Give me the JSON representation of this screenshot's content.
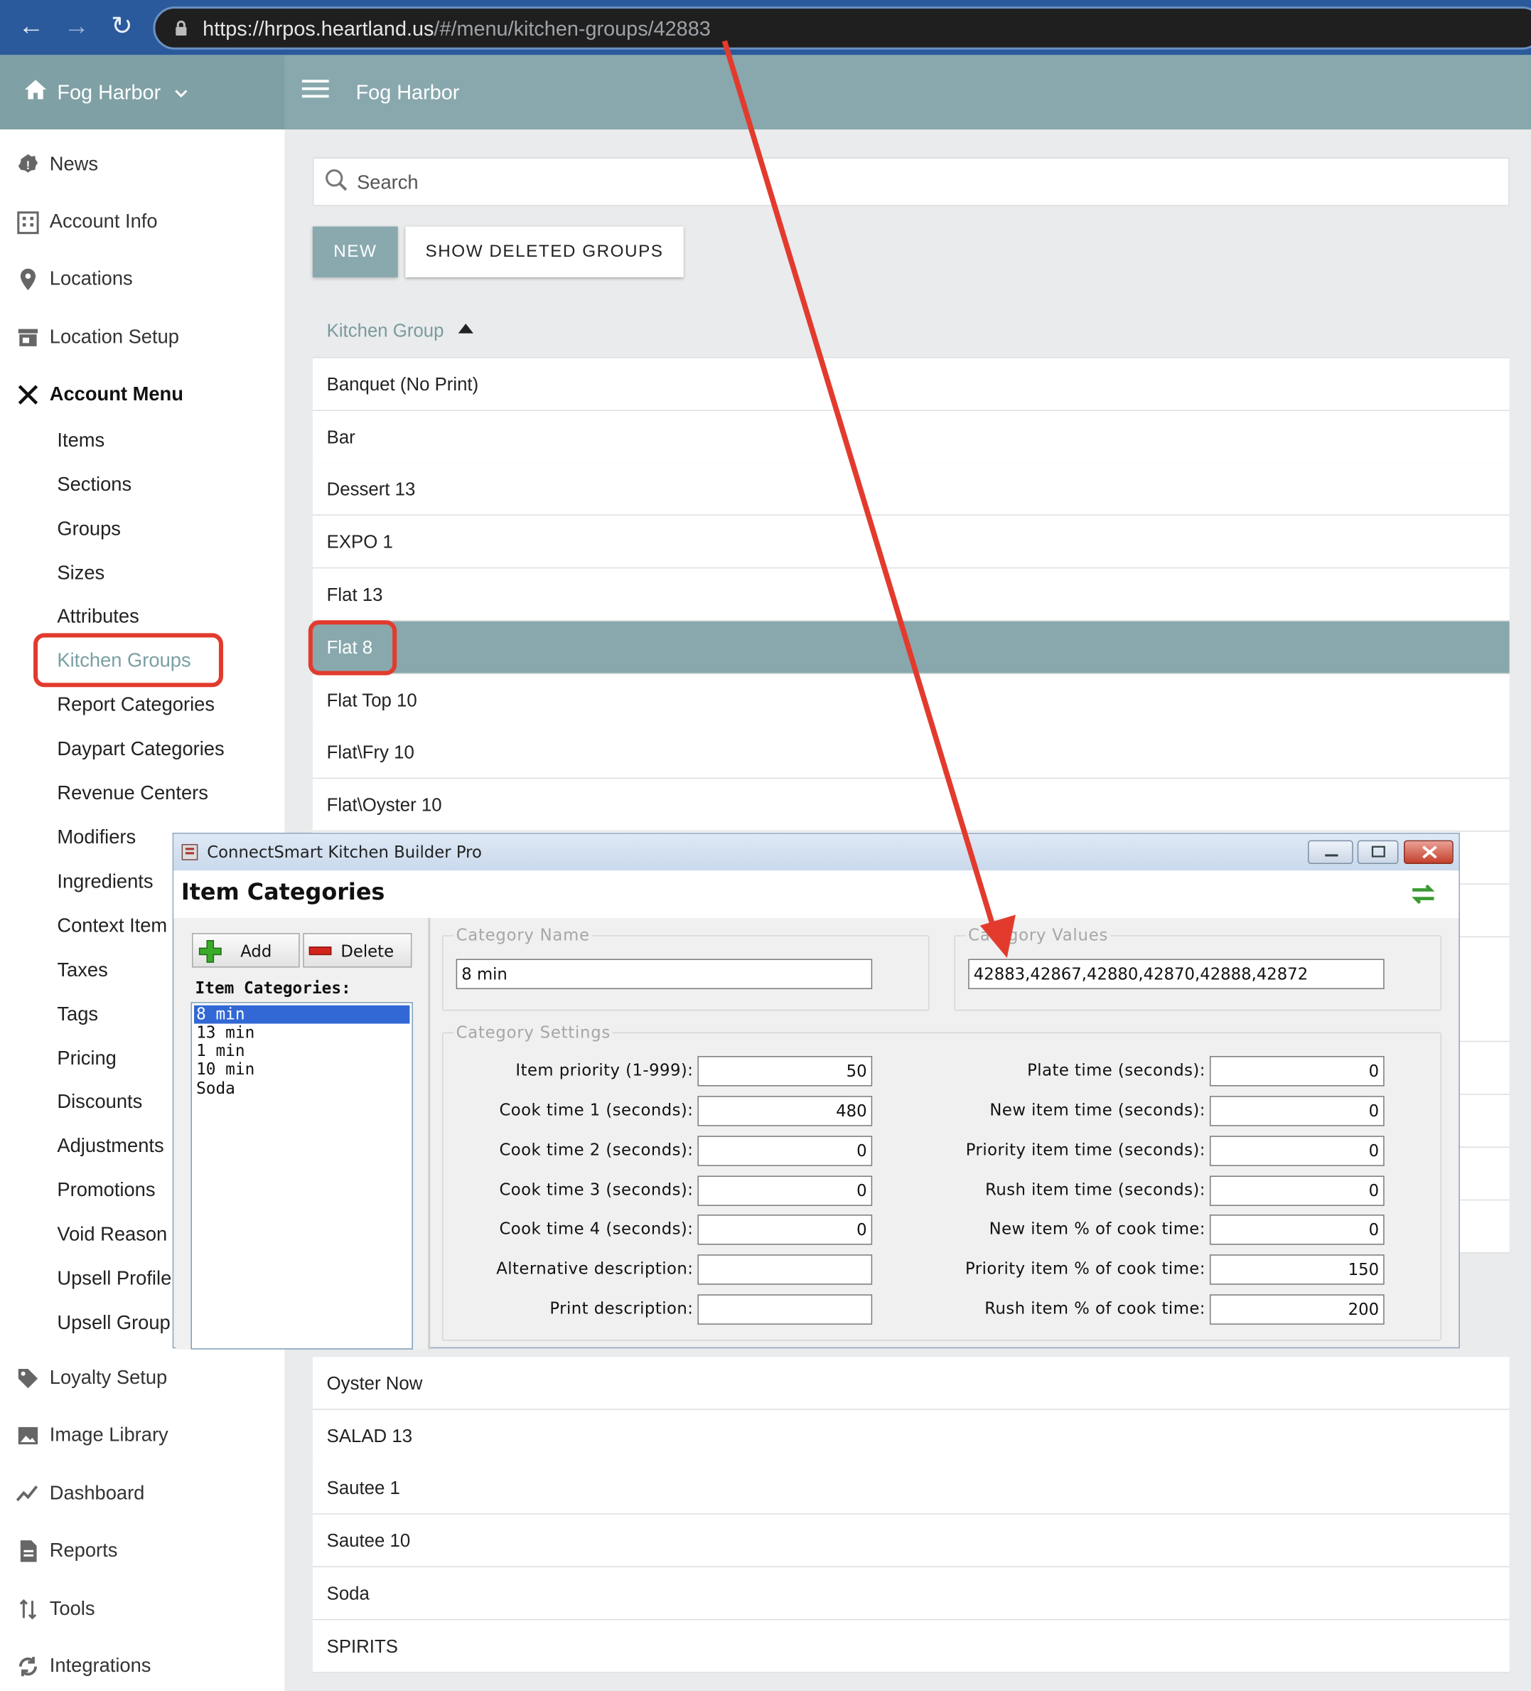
{
  "browser": {
    "url_host": "https://hrpos.heartland.us",
    "url_path": "/#/menu/kitchen-groups/42883"
  },
  "header": {
    "location_name": "Fog Harbor",
    "page_title": "Fog Harbor"
  },
  "sidebar": {
    "top": [
      {
        "label": "News",
        "icon": "news-icon"
      },
      {
        "label": "Account Info",
        "icon": "building-icon"
      },
      {
        "label": "Locations",
        "icon": "map-pin-icon"
      },
      {
        "label": "Location Setup",
        "icon": "store-icon"
      },
      {
        "label": "Account Menu",
        "icon": "utensils-icon"
      }
    ],
    "submenu": [
      "Items",
      "Sections",
      "Groups",
      "Sizes",
      "Attributes",
      "Kitchen Groups",
      "Report Categories",
      "Daypart Categories",
      "Revenue Centers",
      "Modifiers",
      "Ingredients",
      "Context Item",
      "Taxes",
      "Tags",
      "Pricing",
      "Discounts",
      "Adjustments",
      "Promotions",
      "Void Reason",
      "Upsell Profile",
      "Upsell Group"
    ],
    "bottom": [
      {
        "label": "Loyalty Setup",
        "icon": "tag-icon"
      },
      {
        "label": "Image Library",
        "icon": "image-icon"
      },
      {
        "label": "Dashboard",
        "icon": "chart-line-icon"
      },
      {
        "label": "Reports",
        "icon": "report-icon"
      },
      {
        "label": "Tools",
        "icon": "sort-icon"
      },
      {
        "label": "Integrations",
        "icon": "sync-icon"
      }
    ]
  },
  "main": {
    "search_placeholder": "Search",
    "new_label": "NEW",
    "show_deleted_label": "SHOW DELETED GROUPS",
    "column_header": "Kitchen Group",
    "rows_top": [
      "Banquet (No Print)",
      "Bar",
      "Dessert 13",
      "EXPO 1",
      "Flat 13",
      "Flat 8",
      "Flat Top 10",
      "Flat\\Fry 10",
      "Flat\\Oyster 10"
    ],
    "rows_bottom": [
      "Oyster Now",
      "SALAD 13",
      "Sautee 1",
      "Sautee 10",
      "Soda",
      "SPIRITS"
    ]
  },
  "app_window": {
    "title": "ConnectSmart Kitchen Builder Pro",
    "heading": "Item Categories",
    "add_label": "Add",
    "delete_label": "Delete",
    "list_title": "Item Categories:",
    "list_items": [
      "8 min",
      "13 min",
      "1 min",
      "10 min",
      "Soda"
    ],
    "category_name_title": "Category Name",
    "category_name_value": "8 min",
    "category_values_title": "Category Values",
    "category_values_value": "42883,42867,42880,42870,42888,42872",
    "settings_title": "Category Settings",
    "left_fields": [
      {
        "label": "Item priority (1-999):",
        "value": "50"
      },
      {
        "label": "Cook time 1 (seconds):",
        "value": "480"
      },
      {
        "label": "Cook time 2 (seconds):",
        "value": "0"
      },
      {
        "label": "Cook time 3 (seconds):",
        "value": "0"
      },
      {
        "label": "Cook time 4 (seconds):",
        "value": "0"
      },
      {
        "label": "Alternative description:",
        "value": ""
      },
      {
        "label": "Print description:",
        "value": ""
      }
    ],
    "right_fields": [
      {
        "label": "Plate time (seconds):",
        "value": "0"
      },
      {
        "label": "New item time (seconds):",
        "value": "0"
      },
      {
        "label": "Priority item time (seconds):",
        "value": "0"
      },
      {
        "label": "Rush item time (seconds):",
        "value": "0"
      },
      {
        "label": "New item % of cook time:",
        "value": "0"
      },
      {
        "label": "Priority item % of cook time:",
        "value": "150"
      },
      {
        "label": "Rush item % of cook time:",
        "value": "200"
      }
    ]
  },
  "colors": {
    "accent": "#88a8ad",
    "annotation": "#e23b2e",
    "active_link": "#7a9fa4"
  }
}
